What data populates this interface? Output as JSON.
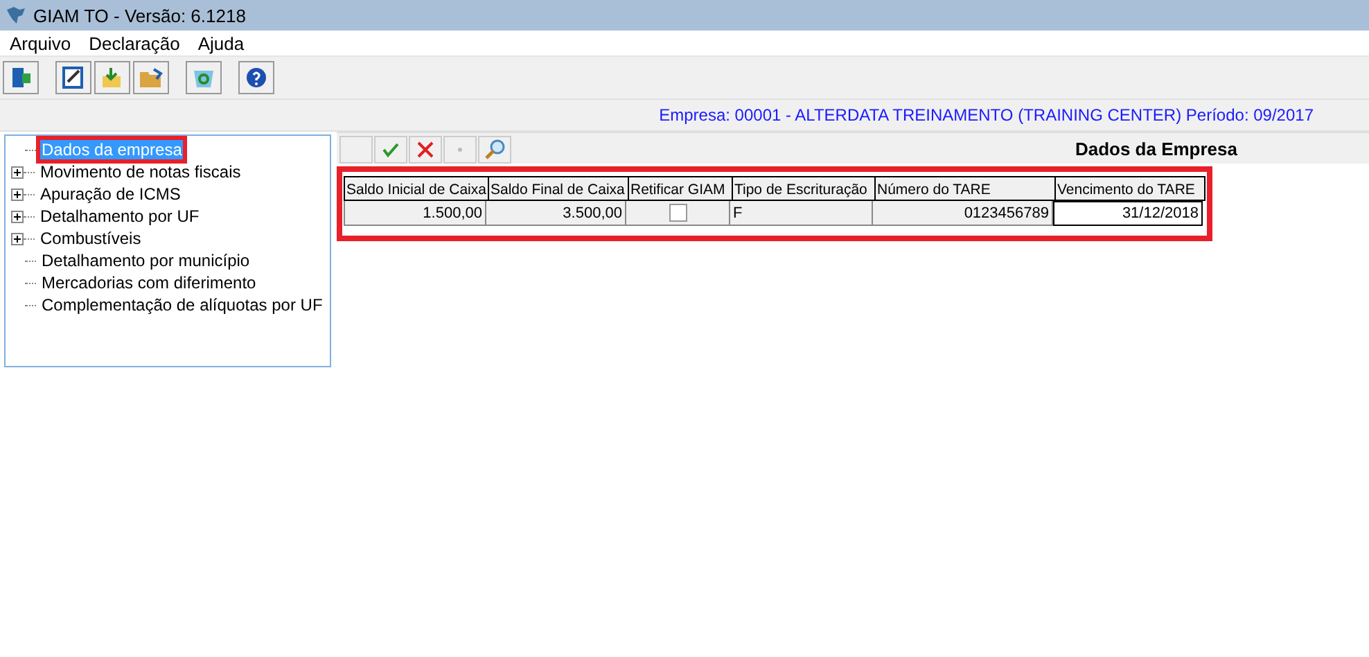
{
  "window": {
    "title": "GIAM TO - Versão: 6.1218"
  },
  "menu": [
    "Arquivo",
    "Declaração",
    "Ajuda"
  ],
  "info_line": "Empresa: 00001 - ALTERDATA TREINAMENTO (TRAINING CENTER) Período: 09/2017",
  "tree": [
    {
      "label": "Dados da empresa",
      "kind": "leaf",
      "selected": true,
      "highlighted": true
    },
    {
      "label": "Movimento de notas fiscais",
      "kind": "branch",
      "selected": false,
      "highlighted": false
    },
    {
      "label": "Apuração de ICMS",
      "kind": "branch",
      "selected": false,
      "highlighted": false
    },
    {
      "label": "Detalhamento por UF",
      "kind": "branch",
      "selected": false,
      "highlighted": false
    },
    {
      "label": "Combustíveis",
      "kind": "branch",
      "selected": false,
      "highlighted": false
    },
    {
      "label": "Detalhamento por município",
      "kind": "leaf",
      "selected": false,
      "highlighted": false
    },
    {
      "label": "Mercadorias com diferimento",
      "kind": "leaf",
      "selected": false,
      "highlighted": false
    },
    {
      "label": "Complementação de alíquotas por UF",
      "kind": "leaf",
      "selected": false,
      "highlighted": false
    }
  ],
  "panel_title": "Dados da Empresa",
  "table": {
    "highlighted": true,
    "columns": [
      "Saldo Inicial de Caixa",
      "Saldo Final de Caixa",
      "Retificar GIAM",
      "Tipo de Escrituração",
      "Número do TARE",
      "Vencimento do TARE"
    ],
    "row": [
      {
        "kind": "number",
        "text": "1.500,00",
        "focused": false
      },
      {
        "kind": "number",
        "text": "3.500,00",
        "focused": false
      },
      {
        "kind": "checkbox",
        "checked": false,
        "focused": false
      },
      {
        "kind": "text",
        "text": "F",
        "focused": false
      },
      {
        "kind": "number",
        "text": "0123456789",
        "focused": false
      },
      {
        "kind": "number",
        "text": "31/12/2018",
        "focused": true
      }
    ]
  }
}
